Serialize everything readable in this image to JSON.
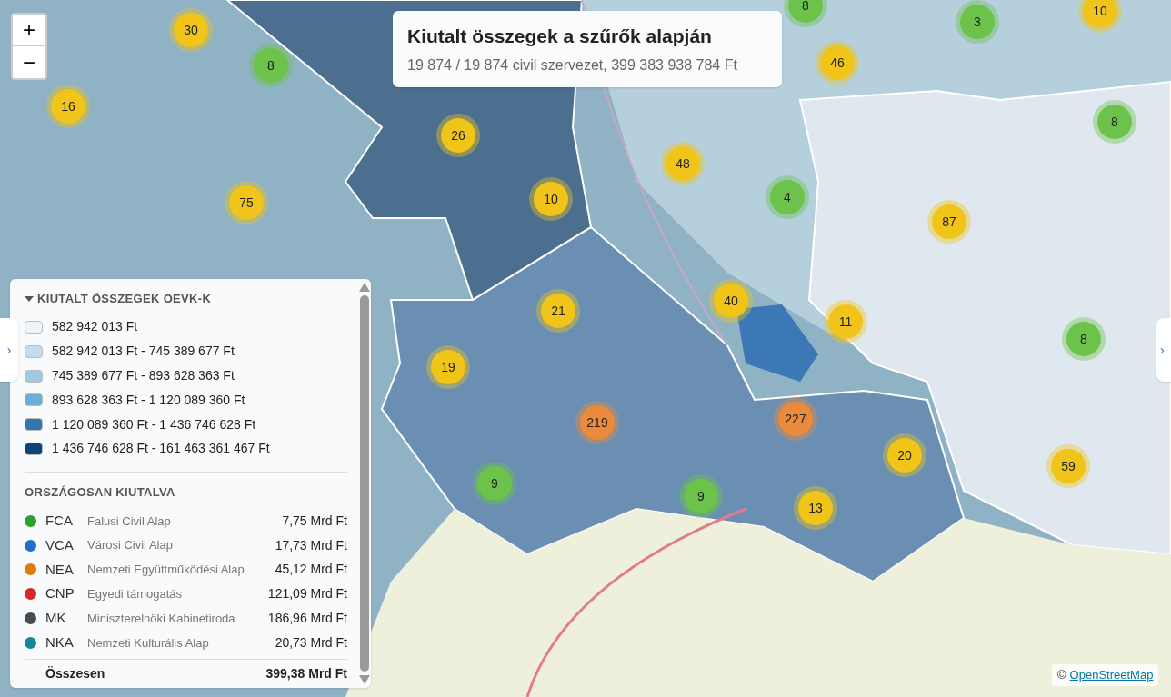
{
  "zoom_controls": {
    "zoom_in": "+",
    "zoom_out": "−"
  },
  "side_toggles": [
    "›",
    "›"
  ],
  "info_box": {
    "title": "Kiutalt összegek a szűrők alapján",
    "subtitle": "19 874 / 19 874 civil szervezet, 399 383 938 784 Ft"
  },
  "clusters": [
    {
      "count": "30",
      "color": "#f0c419"
    },
    {
      "count": "8",
      "color": "#6cc24a"
    },
    {
      "count": "16",
      "color": "#f0c419"
    },
    {
      "count": "26",
      "color": "#f0c419"
    },
    {
      "count": "75",
      "color": "#f0c419"
    },
    {
      "count": "10",
      "color": "#f0c419"
    },
    {
      "count": "8",
      "color": "#6cc24a"
    },
    {
      "count": "3",
      "color": "#6cc24a"
    },
    {
      "count": "10",
      "color": "#f0c419"
    },
    {
      "count": "46",
      "color": "#f0c419"
    },
    {
      "count": "8",
      "color": "#6cc24a"
    },
    {
      "count": "48",
      "color": "#f0c419"
    },
    {
      "count": "4",
      "color": "#6cc24a"
    },
    {
      "count": "87",
      "color": "#f0c419"
    },
    {
      "count": "21",
      "color": "#f0c419"
    },
    {
      "count": "40",
      "color": "#f0c419"
    },
    {
      "count": "11",
      "color": "#f0c419"
    },
    {
      "count": "19",
      "color": "#f0c419"
    },
    {
      "count": "8",
      "color": "#6cc24a"
    },
    {
      "count": "219",
      "color": "#ec8a3c"
    },
    {
      "count": "227",
      "color": "#ec8a3c"
    },
    {
      "count": "20",
      "color": "#f0c419"
    },
    {
      "count": "59",
      "color": "#f0c419"
    },
    {
      "count": "9",
      "color": "#6cc24a"
    },
    {
      "count": "9",
      "color": "#6cc24a"
    },
    {
      "count": "13",
      "color": "#f0c419"
    }
  ],
  "legend": {
    "title": "KIUTALT ÖSSZEGEK OEVK-K",
    "ranges": [
      {
        "label": "582 942 013 Ft",
        "color": "#f1f4f7"
      },
      {
        "label": "582 942 013 Ft - 745 389 677 Ft",
        "color": "#c6dbef"
      },
      {
        "label": "745 389 677 Ft - 893 628 363 Ft",
        "color": "#9ecae1"
      },
      {
        "label": "893 628 363 Ft - 1 120 089 360 Ft",
        "color": "#6baed6"
      },
      {
        "label": "1 120 089 360 Ft - 1 436 746 628 Ft",
        "color": "#3373b0"
      },
      {
        "label": "1 436 746 628 Ft - 161 463 361 467 Ft",
        "color": "#0d4376"
      }
    ],
    "national_title": "ORSZÁGOSAN KIUTALVA",
    "funds": [
      {
        "code": "FCA",
        "name": "Falusi Civil Alap",
        "amount": "7,75 Mrd Ft",
        "color": "#2ca02c"
      },
      {
        "code": "VCA",
        "name": "Városi Civil Alap",
        "amount": "17,73 Mrd Ft",
        "color": "#1f6fce"
      },
      {
        "code": "NEA",
        "name": "Nemzeti Együttműködési Alap",
        "amount": "45,12 Mrd Ft",
        "color": "#e07b0c"
      },
      {
        "code": "CNP",
        "name": "Egyedi támogatás",
        "amount": "121,09 Mrd Ft",
        "color": "#d62728"
      },
      {
        "code": "MK",
        "name": "Miniszterelnöki Kabinetiroda",
        "amount": "186,96 Mrd Ft",
        "color": "#454b52"
      },
      {
        "code": "NKA",
        "name": "Nemzeti Kulturális Alap",
        "amount": "20,73 Mrd Ft",
        "color": "#118a96"
      }
    ],
    "total_label": "Összesen",
    "total_amount": "399,38 Mrd Ft"
  },
  "attribution": {
    "symbol": "©",
    "link": "OpenStreetMap"
  }
}
